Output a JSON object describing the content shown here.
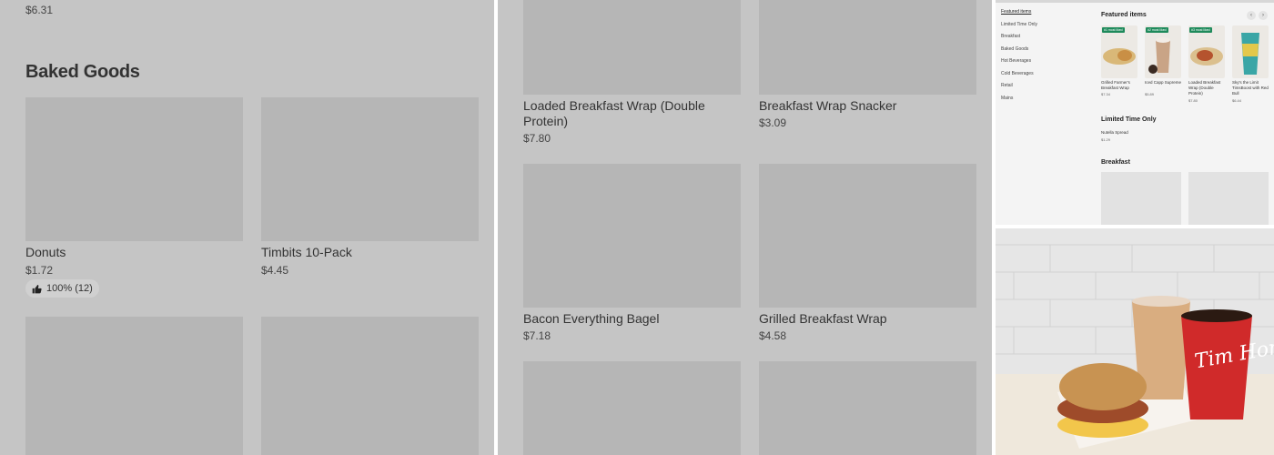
{
  "panel1": {
    "top_price": "$6.31",
    "section_title": "Baked Goods",
    "items": [
      {
        "name": "Donuts",
        "price": "$1.72",
        "rating": "100% (12)"
      },
      {
        "name": "Timbits 10-Pack",
        "price": "$4.45"
      }
    ]
  },
  "panel2": {
    "items": [
      {
        "name": "Loaded Breakfast Wrap (Double Protein)",
        "price": "$7.80"
      },
      {
        "name": "Breakfast Wrap Snacker",
        "price": "$3.09"
      },
      {
        "name": "Bacon Everything Bagel",
        "price": "$7.18"
      },
      {
        "name": "Grilled Breakfast Wrap",
        "price": "$4.58"
      }
    ]
  },
  "panel3": {
    "nav": [
      "Featured items",
      "Limited Time Only",
      "Breakfast",
      "Baked Goods",
      "Hot Beverages",
      "Cold Beverages",
      "Retail",
      "Mains"
    ],
    "featured_title": "Featured items",
    "prev_label": "‹",
    "next_label": "›",
    "featured": [
      {
        "badge": "#1 most liked",
        "name": "Grilled Farmer's Breakfast Wrap",
        "price": "$7.34"
      },
      {
        "badge": "#2 most liked",
        "name": "Iced Capp Supreme",
        "price": "$5.89"
      },
      {
        "badge": "#3 most liked",
        "name": "Loaded Breakfast Wrap (Double Protein)",
        "price": "$7.80"
      },
      {
        "name": "Sky's the Limit TimsBoost with Red Bull",
        "price": "$6.44"
      }
    ],
    "limited_title": "Limited Time Only",
    "limited_item": "Nutella Spread",
    "limited_price": "$1.29",
    "breakfast_title": "Breakfast"
  },
  "panel4": {
    "cup_brand": "Tim Hortons"
  },
  "colors": {
    "overlay_gray": "#c5c5c5",
    "tile_gray": "#b6b6b6",
    "badge_green": "#1e8a5b",
    "cup_red": "#d02a2a"
  }
}
